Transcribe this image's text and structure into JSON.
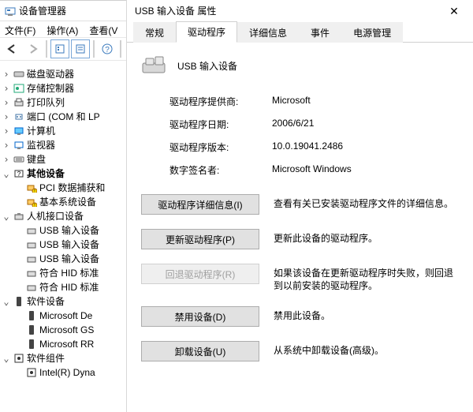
{
  "dm": {
    "title": "设备管理器",
    "menu": {
      "file": "文件(F)",
      "action": "操作(A)",
      "view": "查看(V"
    }
  },
  "tree": {
    "n1": "磁盘驱动器",
    "n2": "存储控制器",
    "n3": "打印队列",
    "n4": "端口 (COM 和 LP",
    "n5": "计算机",
    "n6": "监视器",
    "n7": "键盘",
    "n8": "其他设备",
    "n8a": "PCI 数据捕获和",
    "n8b": "基本系统设备",
    "n9": "人机接口设备",
    "n9a": "USB 输入设备",
    "n9b": "USB 输入设备",
    "n9c": "USB 输入设备",
    "n9d": "符合 HID 标准",
    "n9e": "符合 HID 标准",
    "n10": "软件设备",
    "n10a": "Microsoft De",
    "n10b": "Microsoft GS",
    "n10c": "Microsoft RR",
    "n11": "软件组件",
    "n11a": "Intel(R) Dyna"
  },
  "dlg": {
    "title": "USB 输入设备 属性",
    "tabs": {
      "t1": "常规",
      "t2": "驱动程序",
      "t3": "详细信息",
      "t4": "事件",
      "t5": "电源管理"
    },
    "device_name": "USB 输入设备",
    "labels": {
      "provider": "驱动程序提供商:",
      "date": "驱动程序日期:",
      "version": "驱动程序版本:",
      "signer": "数字签名者:"
    },
    "values": {
      "provider": "Microsoft",
      "date": "2006/6/21",
      "version": "10.0.19041.2486",
      "signer": "Microsoft Windows"
    },
    "buttons": {
      "detail": "驱动程序详细信息(I)",
      "update": "更新驱动程序(P)",
      "rollback": "回退驱动程序(R)",
      "disable": "禁用设备(D)",
      "uninstall": "卸载设备(U)"
    },
    "descs": {
      "detail": "查看有关已安装驱动程序文件的详细信息。",
      "update": "更新此设备的驱动程序。",
      "rollback": "如果该设备在更新驱动程序时失败，则回退到以前安装的驱动程序。",
      "disable": "禁用此设备。",
      "uninstall": "从系统中卸载设备(高级)。"
    }
  }
}
